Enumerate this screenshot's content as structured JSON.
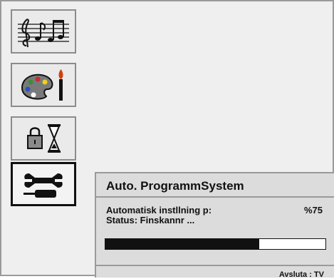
{
  "menu": {
    "items": [
      {
        "name": "sound",
        "icon": "music-notes-icon",
        "active": false
      },
      {
        "name": "picture",
        "icon": "paint-palette-icon",
        "active": false
      },
      {
        "name": "features",
        "icon": "lock-hourglass-icon",
        "active": false
      },
      {
        "name": "install",
        "icon": "wrench-screwdriver-icon",
        "active": true
      }
    ]
  },
  "dialog": {
    "title": "Auto. ProgrammSystem",
    "status_line_1": "Automatisk instllning p:",
    "status_line_2": "Status: Finskannr ...",
    "percent_label": "%75",
    "progress": 0.7,
    "footer_hint": "Avsluta : TV"
  },
  "colors": {
    "background": "#efefef",
    "panel": "#dcdcdc",
    "progress_fill": "#111111",
    "active_border": "#101010"
  }
}
